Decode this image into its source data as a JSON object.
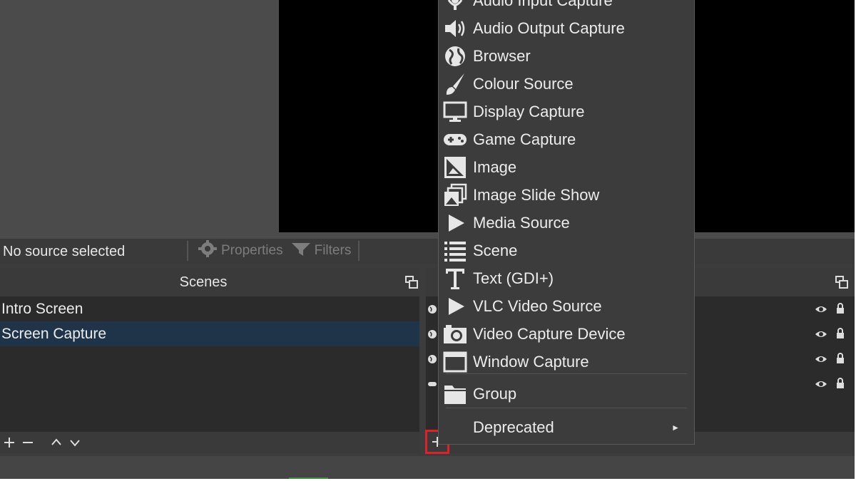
{
  "source_bar": {
    "status": "No source selected",
    "properties_label": "Properties",
    "filters_label": "Filters"
  },
  "scenes": {
    "title": "Scenes",
    "items": [
      "Intro Screen",
      "Screen Capture"
    ],
    "selected_index": 1
  },
  "sources": {
    "row_count": 4
  },
  "add_menu": {
    "items": [
      {
        "label": "Audio Input Capture",
        "icon": "microphone-icon"
      },
      {
        "label": "Audio Output Capture",
        "icon": "speaker-icon"
      },
      {
        "label": "Browser",
        "icon": "globe-icon"
      },
      {
        "label": "Colour Source",
        "icon": "paintbrush-icon"
      },
      {
        "label": "Display Capture",
        "icon": "monitor-icon"
      },
      {
        "label": "Game Capture",
        "icon": "gamepad-icon"
      },
      {
        "label": "Image",
        "icon": "image-icon"
      },
      {
        "label": "Image Slide Show",
        "icon": "slideshow-icon"
      },
      {
        "label": "Media Source",
        "icon": "play-icon"
      },
      {
        "label": "Scene",
        "icon": "list-icon"
      },
      {
        "label": "Text (GDI+)",
        "icon": "text-icon"
      },
      {
        "label": "VLC Video Source",
        "icon": "play-icon"
      },
      {
        "label": "Video Capture Device",
        "icon": "camera-icon"
      },
      {
        "label": "Window Capture",
        "icon": "window-icon"
      }
    ],
    "group_label": "Group",
    "deprecated_label": "Deprecated"
  },
  "colors": {
    "selection": "#203449",
    "highlight_box": "#e0202a"
  }
}
